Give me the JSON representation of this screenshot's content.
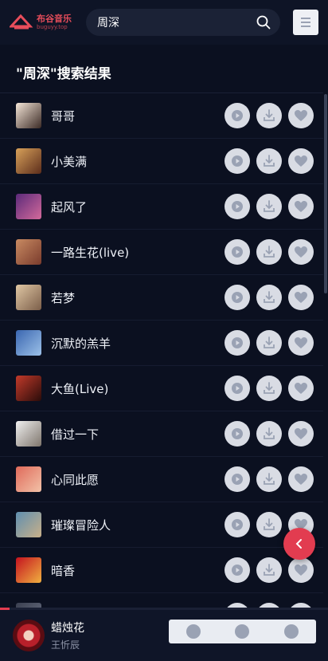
{
  "header": {
    "logo_main": "布谷音乐",
    "logo_sub": "buguyy.top",
    "search_value": "周深"
  },
  "results": {
    "title": "\"周深\"搜索结果",
    "songs": [
      {
        "title": "哥哥",
        "cover": [
          "#f5e6d8",
          "#3b2a25"
        ]
      },
      {
        "title": "小美满",
        "cover": [
          "#d8a15a",
          "#5c2d1b"
        ]
      },
      {
        "title": "起风了",
        "cover": [
          "#5b2a7a",
          "#d46a9b"
        ]
      },
      {
        "title": "一路生花(live)",
        "cover": [
          "#c88a62",
          "#7a3b2c"
        ]
      },
      {
        "title": "若梦",
        "cover": [
          "#e0c7a4",
          "#7b5e49"
        ]
      },
      {
        "title": "沉默的羔羊",
        "cover": [
          "#3a66b0",
          "#9cc1e8"
        ]
      },
      {
        "title": "大鱼(Live)",
        "cover": [
          "#c23a2a",
          "#2a0c0a"
        ]
      },
      {
        "title": "借过一下",
        "cover": [
          "#f0f0f0",
          "#7e756c"
        ]
      },
      {
        "title": "心同此愿",
        "cover": [
          "#e06a5a",
          "#f2c2a8"
        ]
      },
      {
        "title": "璀璨冒险人",
        "cover": [
          "#5f8fb0",
          "#c9b089"
        ]
      },
      {
        "title": "暗香",
        "cover": [
          "#c4121f",
          "#f0b040"
        ]
      },
      {
        "title": "",
        "cover": [
          "#3a3f50",
          "#6d7385"
        ]
      }
    ]
  },
  "player": {
    "title": "蜡烛花",
    "artist": "王忻辰",
    "progress_fraction": 0.03
  },
  "colors": {
    "accent": "#e23c50",
    "background": "#0b1020"
  },
  "icons": {
    "play": "play-icon",
    "download": "download-icon",
    "like": "heart-icon",
    "search": "search-icon",
    "menu": "menu-icon",
    "back": "chevron-left-icon"
  }
}
